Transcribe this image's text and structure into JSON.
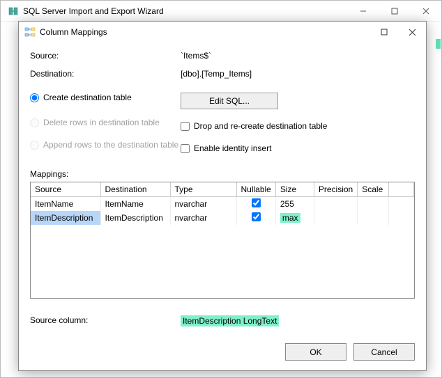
{
  "parent": {
    "title": "SQL Server Import and Export Wizard"
  },
  "modal": {
    "title": "Column Mappings"
  },
  "info": {
    "source_label": "Source:",
    "source_value": "`Items$`",
    "dest_label": "Destination:",
    "dest_value": "[dbo].[Temp_Items]"
  },
  "options": {
    "create_label": "Create destination table",
    "delete_label": "Delete rows in destination table",
    "append_label": "Append rows to the destination table",
    "edit_sql": "Edit SQL...",
    "drop_label": "Drop and re-create destination table",
    "identity_label": "Enable identity insert"
  },
  "grid": {
    "title": "Mappings:",
    "headers": {
      "source": "Source",
      "destination": "Destination",
      "type": "Type",
      "nullable": "Nullable",
      "size": "Size",
      "precision": "Precision",
      "scale": "Scale"
    },
    "rows": [
      {
        "source": "ItemName",
        "destination": "ItemName",
        "type": "nvarchar",
        "nullable": true,
        "size": "255",
        "precision": "",
        "scale": "",
        "selected": false,
        "size_hl": false
      },
      {
        "source": "ItemDescription",
        "destination": "ItemDescription",
        "type": "nvarchar",
        "nullable": true,
        "size": "max",
        "precision": "",
        "scale": "",
        "selected": true,
        "size_hl": true
      }
    ]
  },
  "source_column": {
    "label": "Source column:",
    "value": "ItemDescription LongText"
  },
  "buttons": {
    "ok": "OK",
    "cancel": "Cancel"
  }
}
